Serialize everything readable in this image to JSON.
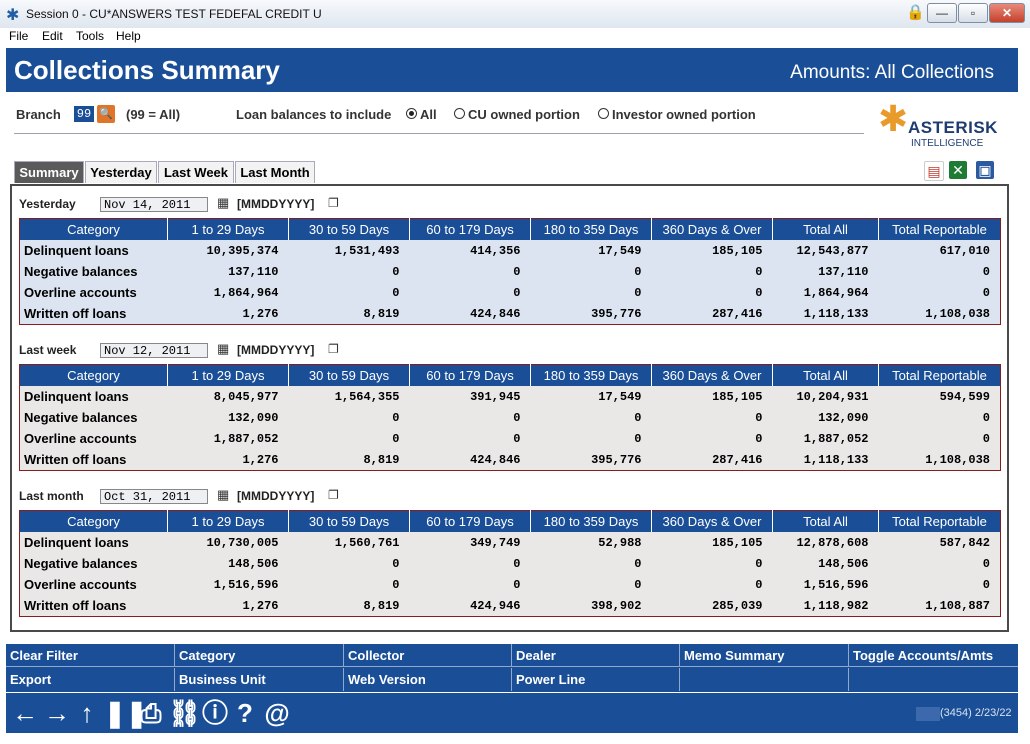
{
  "window": {
    "title": "Session 0 - CU*ANSWERS TEST FEDEFAL CREDIT U",
    "minimize": "—",
    "maximize": "▫",
    "close": "✕"
  },
  "menu": [
    "File",
    "Edit",
    "Tools",
    "Help"
  ],
  "header": {
    "title": "Collections Summary",
    "subtitle": "Amounts: All Collections"
  },
  "filters": {
    "branch_label": "Branch",
    "branch_value": "99",
    "branch_hint": "(99 = All)",
    "balances_label": "Loan balances to include",
    "options": [
      {
        "label": "All",
        "selected": true
      },
      {
        "label": "CU owned portion",
        "selected": false
      },
      {
        "label": "Investor owned portion",
        "selected": false
      }
    ]
  },
  "logo": {
    "line1": "ASTERISK",
    "line2": "INTELLIGENCE"
  },
  "tabs": [
    "Summary",
    "Yesterday",
    "Last Week",
    "Last Month"
  ],
  "columns": [
    "Category",
    "1 to 29 Days",
    "30 to 59 Days",
    "60 to 179 Days",
    "180 to 359 Days",
    "360 Days & Over",
    "Total All",
    "Total Reportable"
  ],
  "sections": [
    {
      "label": "Yesterday",
      "date": "Nov 14, 2011",
      "format": "[MMDDYYYY]",
      "rows": [
        [
          "Delinquent loans",
          "10,395,374",
          "1,531,493",
          "414,356",
          "17,549",
          "185,105",
          "12,543,877",
          "617,010"
        ],
        [
          "Negative balances",
          "137,110",
          "0",
          "0",
          "0",
          "0",
          "137,110",
          "0"
        ],
        [
          "Overline accounts",
          "1,864,964",
          "0",
          "0",
          "0",
          "0",
          "1,864,964",
          "0"
        ],
        [
          "Written off loans",
          "1,276",
          "8,819",
          "424,846",
          "395,776",
          "287,416",
          "1,118,133",
          "1,108,038"
        ]
      ]
    },
    {
      "label": "Last week",
      "date": "Nov 12, 2011",
      "format": "[MMDDYYYY]",
      "rows": [
        [
          "Delinquent loans",
          "8,045,977",
          "1,564,355",
          "391,945",
          "17,549",
          "185,105",
          "10,204,931",
          "594,599"
        ],
        [
          "Negative balances",
          "132,090",
          "0",
          "0",
          "0",
          "0",
          "132,090",
          "0"
        ],
        [
          "Overline accounts",
          "1,887,052",
          "0",
          "0",
          "0",
          "0",
          "1,887,052",
          "0"
        ],
        [
          "Written off loans",
          "1,276",
          "8,819",
          "424,846",
          "395,776",
          "287,416",
          "1,118,133",
          "1,108,038"
        ]
      ]
    },
    {
      "label": "Last month",
      "date": "Oct 31, 2011",
      "format": "[MMDDYYYY]",
      "rows": [
        [
          "Delinquent loans",
          "10,730,005",
          "1,560,761",
          "349,749",
          "52,988",
          "185,105",
          "12,878,608",
          "587,842"
        ],
        [
          "Negative balances",
          "148,506",
          "0",
          "0",
          "0",
          "0",
          "148,506",
          "0"
        ],
        [
          "Overline accounts",
          "1,516,596",
          "0",
          "0",
          "0",
          "0",
          "1,516,596",
          "0"
        ],
        [
          "Written off loans",
          "1,276",
          "8,819",
          "424,946",
          "398,902",
          "285,039",
          "1,118,982",
          "1,108,887"
        ]
      ]
    }
  ],
  "function_keys": [
    [
      "Clear Filter",
      "Category",
      "Collector",
      "Dealer",
      "Memo Summary",
      "Toggle Accounts/Amts"
    ],
    [
      "Export",
      "Business Unit",
      "Web Version",
      "Power Line",
      "",
      ""
    ]
  ],
  "toolbar_icons": [
    "back-arrow-icon",
    "forward-arrow-icon",
    "up-arrow-icon",
    "pause-icon",
    "print-icon",
    "link-icon",
    "info-icon",
    "help-icon",
    "at-icon"
  ],
  "status": "(3454) 2/23/22"
}
